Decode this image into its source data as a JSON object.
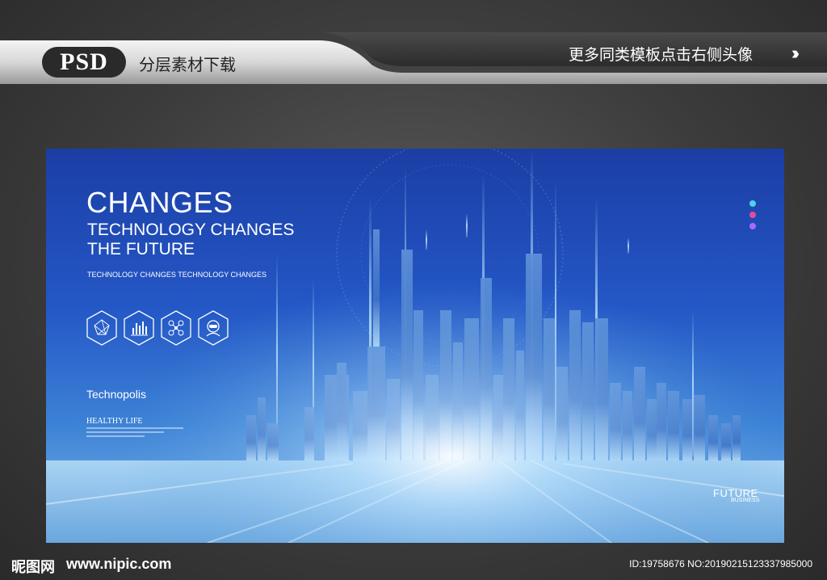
{
  "banner": {
    "badge": "PSD",
    "left_text": "分层素材下载",
    "right_text": "更多同类模板点击右侧头像",
    "arrows_icon": "triple-chevron-right-icon"
  },
  "poster": {
    "title": "CHANGES",
    "subtitle": "TECHNOLOGY CHANGES THE FUTURE",
    "tagline": "TECHNOLOGY CHANGES  TECHNOLOGY CHANGES",
    "icons": [
      "network-icon",
      "bar-chart-icon",
      "molecule-icon",
      "astronaut-icon"
    ],
    "technopolis": "Technopolis",
    "healthy_life": "HEALTHY LIFE",
    "future_title": "FUTURE",
    "future_sub": "BUSINESS",
    "dot_colors": [
      "#4fd1e8",
      "#e04da0",
      "#a66ef0"
    ]
  },
  "footer": {
    "logo_cn": "昵图网",
    "url": "www.nipic.com",
    "id_text": "ID:19758676 NO:20190215123337985000"
  }
}
